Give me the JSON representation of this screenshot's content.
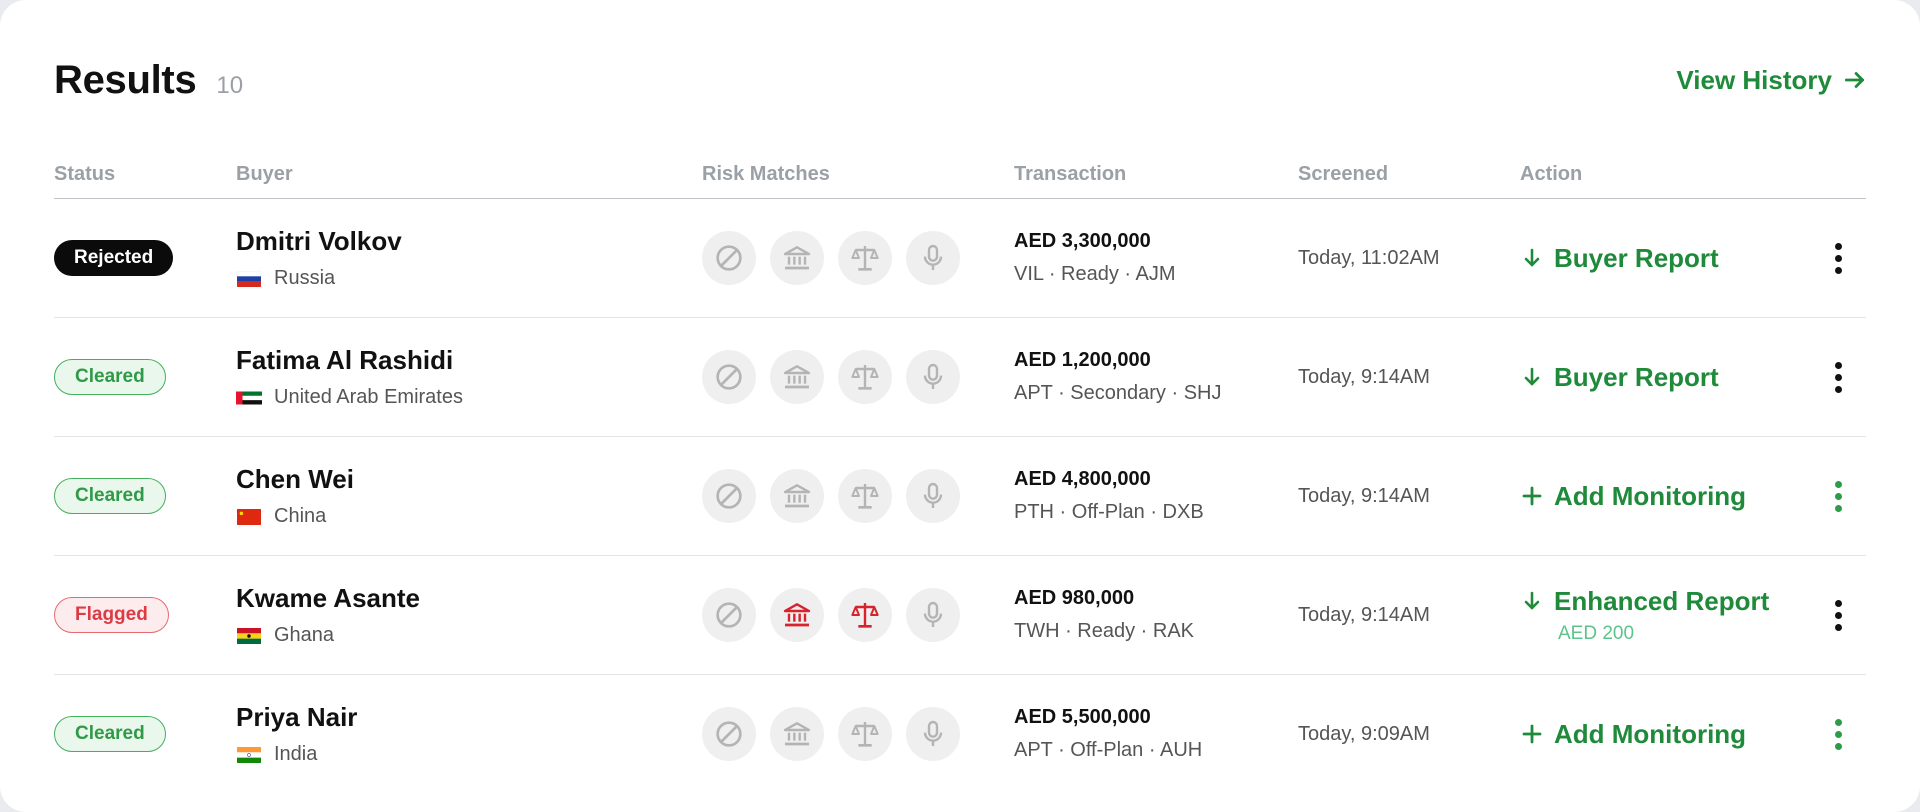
{
  "header": {
    "title": "Results",
    "count": "10",
    "history_label": "View History"
  },
  "columns": {
    "status": "Status",
    "buyer": "Buyer",
    "risk": "Risk Matches",
    "transaction": "Transaction",
    "screened": "Screened",
    "action": "Action"
  },
  "rows": [
    {
      "status": "Rejected",
      "name": "Dmitri Volkov",
      "country": "Russia",
      "amount": "AED 3,300,000",
      "meta": "VIL · Ready · AJM",
      "screened": "Today, 11:02AM",
      "action": "Buyer Report",
      "action_sub": ""
    },
    {
      "status": "Cleared",
      "name": "Fatima Al Rashidi",
      "country": "United Arab Emirates",
      "amount": "AED 1,200,000",
      "meta": "APT · Secondary · SHJ",
      "screened": "Today, 9:14AM",
      "action": "Buyer Report",
      "action_sub": ""
    },
    {
      "status": "Cleared",
      "name": "Chen Wei",
      "country": "China",
      "amount": "AED 4,800,000",
      "meta": "PTH · Off-Plan · DXB",
      "screened": "Today, 9:14AM",
      "action": "Add Monitoring",
      "action_sub": ""
    },
    {
      "status": "Flagged",
      "name": "Kwame Asante",
      "country": "Ghana",
      "amount": "AED 980,000",
      "meta": "TWH · Ready · RAK",
      "screened": "Today, 9:14AM",
      "action": "Enhanced Report",
      "action_sub": "AED 200"
    },
    {
      "status": "Cleared",
      "name": "Priya Nair",
      "country": "India",
      "amount": "AED 5,500,000",
      "meta": "APT · Off-Plan · AUH",
      "screened": "Today, 9:09AM",
      "action": "Add Monitoring",
      "action_sub": ""
    }
  ],
  "risk_icons": [
    "prohibited-icon",
    "bank-icon",
    "scales-icon",
    "microphone-icon"
  ],
  "flags": [
    "flag-russia-icon",
    "flag-uae-icon",
    "flag-china-icon",
    "flag-ghana-icon",
    "flag-india-icon"
  ],
  "colors": {
    "accent": "#1f8a3a",
    "cleared": "#2f9a47",
    "flagged": "#dc3b43",
    "rejected": "#0b0b0b",
    "risk_alert": "#d7232b",
    "risk_idle": "#b4b4b4"
  }
}
